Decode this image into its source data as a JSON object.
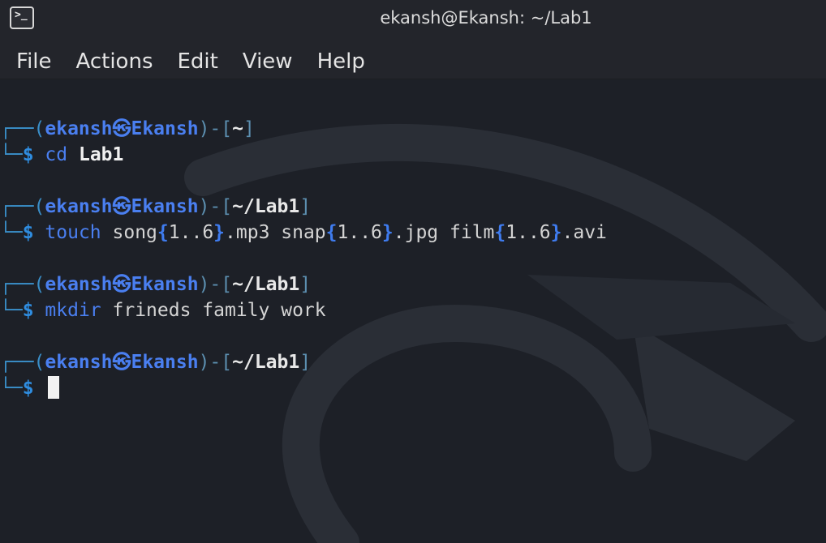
{
  "window": {
    "title": "ekansh@Ekansh: ~/Lab1",
    "icon": "terminal-icon",
    "icon_glyph": ">_"
  },
  "menu": [
    "File",
    "Actions",
    "Edit",
    "View",
    "Help"
  ],
  "colors": {
    "background": "#1d2027",
    "prompt_user": "#4a7ff0",
    "prompt_box": "#3a8fc9",
    "command": "#4a7ff0",
    "text": "#d4d4d4",
    "cursor": "#f2f2f2"
  },
  "prompt": {
    "open": "┌──(",
    "user": "ekansh",
    "at": "㉿",
    "host": "Ekansh",
    "close_prefix": ")-[",
    "close_suffix": "]",
    "line2": "└─",
    "dollar": "$"
  },
  "entries": [
    {
      "path": "~",
      "cmd": "cd",
      "args": [
        {
          "t": " ",
          "k": "arg"
        },
        {
          "t": "Lab1",
          "k": "bold"
        }
      ]
    },
    {
      "path": "~/Lab1",
      "cmd": "touch",
      "args": [
        {
          "t": " song",
          "k": "arg"
        },
        {
          "t": "{",
          "k": "brace"
        },
        {
          "t": "1..6",
          "k": "arg"
        },
        {
          "t": "}",
          "k": "brace"
        },
        {
          "t": ".mp3 snap",
          "k": "arg"
        },
        {
          "t": "{",
          "k": "brace"
        },
        {
          "t": "1..6",
          "k": "arg"
        },
        {
          "t": "}",
          "k": "brace"
        },
        {
          "t": ".jpg film",
          "k": "arg"
        },
        {
          "t": "{",
          "k": "brace"
        },
        {
          "t": "1..6",
          "k": "arg"
        },
        {
          "t": "}",
          "k": "brace"
        },
        {
          "t": ".avi",
          "k": "arg"
        }
      ]
    },
    {
      "path": "~/Lab1",
      "cmd": "mkdir",
      "args": [
        {
          "t": " frineds family work",
          "k": "arg"
        }
      ]
    },
    {
      "path": "~/Lab1",
      "cmd": "",
      "args": [],
      "cursor": true
    }
  ]
}
